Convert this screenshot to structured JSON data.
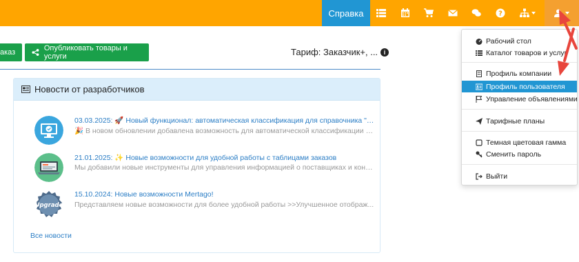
{
  "topbar": {
    "help_label": "Справка",
    "icons": [
      "list-icon",
      "calendar-icon",
      "cart-icon",
      "envelope-icon",
      "chat-icon",
      "question-icon",
      "sitemap-icon",
      "user-icon"
    ],
    "accent_color": "#ffa500",
    "active_color": "#2196d3"
  },
  "actions": {
    "order_label": "аказ",
    "publish_label": "Опубликовать товары и услуги"
  },
  "tariff": {
    "label": "Тариф: Заказчик+, ..."
  },
  "news": {
    "header": "Новости от разработчиков",
    "items": [
      {
        "title": "03.03.2025: 🚀 Новый функционал: автоматическая классификация для справочника \"Мо...",
        "description": "🎉 В новом обновлении добавлена возможность для автоматической классификации н..."
      },
      {
        "title": "21.01.2025: ✨ Новые возможности для удобной работы с таблицами заказов",
        "description": "Мы добавили новые инструменты для управления информацией о поставщиках и контр..."
      },
      {
        "title": "15.10.2024: Новые возможности Mertago!",
        "description": "Представляем новые возможности для более удобной работы >>Улучшенное отображ..."
      }
    ],
    "all_news_label": "Все новости",
    "upgrade_badge_text": "Upgrade"
  },
  "user_menu": {
    "items": [
      {
        "label": "Рабочий стол",
        "icon": "dashboard-icon"
      },
      {
        "label": "Каталог товаров и услуг",
        "icon": "list-icon"
      },
      {
        "label": "Профиль компании",
        "icon": "building-icon"
      },
      {
        "label": "Профиль пользователя",
        "icon": "id-card-icon",
        "active": true
      },
      {
        "label": "Управление объявлениями",
        "icon": "flag-icon"
      },
      {
        "label": "Тарифные планы",
        "icon": "paper-plane-icon"
      },
      {
        "label": "Темная цветовая гамма",
        "icon": "square-icon"
      },
      {
        "label": "Сменить пароль",
        "icon": "key-icon"
      },
      {
        "label": "Выйти",
        "icon": "sign-out-icon"
      }
    ]
  }
}
